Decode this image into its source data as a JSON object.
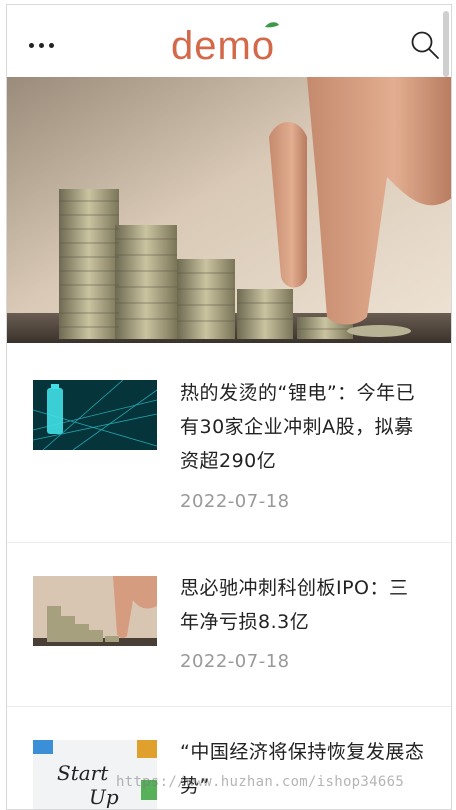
{
  "header": {
    "menu_icon": "more-dots-icon",
    "logo_text": "demo",
    "search_icon": "search-icon",
    "brand_color": "#d4694a"
  },
  "hero": {
    "image": "coins-stacks-hand-photo"
  },
  "news": [
    {
      "title": "热的发烫的“锂电”：今年已有30家企业冲刺A股，拟募资超290亿",
      "date": "2022-07-18",
      "thumb": "battery-tech-graphic"
    },
    {
      "title": "思必驰冲刺科创板IPO：三年净亏损8.3亿",
      "date": "2022-07-18",
      "thumb": "coins-stacks-hand-photo"
    },
    {
      "title": "“中国经济将保持恢复发展态势”",
      "thumb": "start-up-sketch-photo"
    }
  ],
  "watermark": "https://www.huzhan.com/ishop34665"
}
